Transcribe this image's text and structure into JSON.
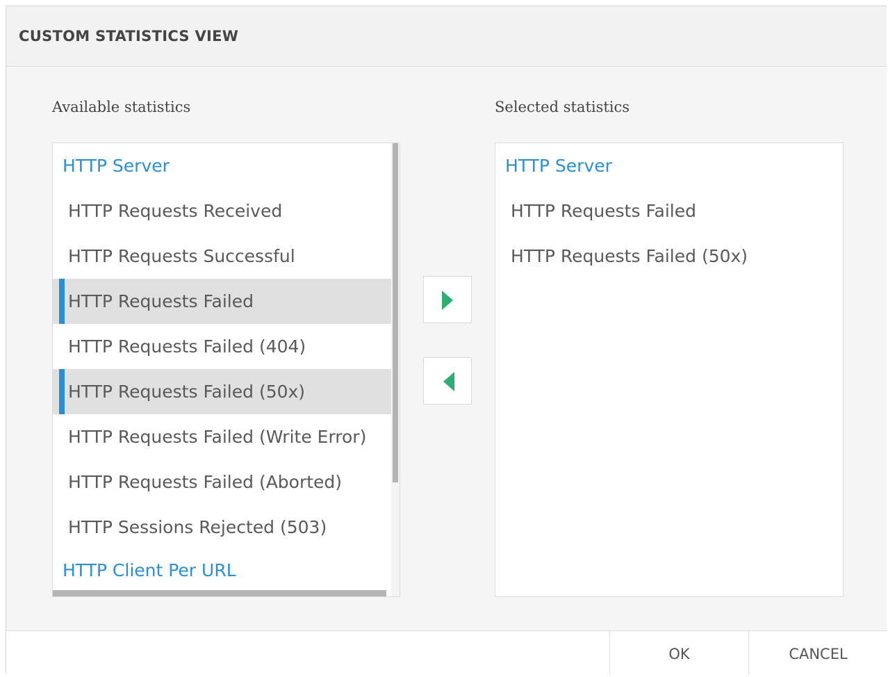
{
  "dialog": {
    "title": "CUSTOM STATISTICS VIEW",
    "available_label": "Available statistics",
    "selected_label": "Selected statistics"
  },
  "available": {
    "items": [
      {
        "label": "HTTP Server",
        "type": "group"
      },
      {
        "label": "HTTP Requests Received",
        "type": "item"
      },
      {
        "label": "HTTP Requests Successful",
        "type": "item"
      },
      {
        "label": "HTTP Requests Failed",
        "type": "item",
        "selected": true
      },
      {
        "label": "HTTP Requests Failed (404)",
        "type": "item"
      },
      {
        "label": "HTTP Requests Failed (50x)",
        "type": "item",
        "selected": true
      },
      {
        "label": "HTTP Requests Failed (Write Error)",
        "type": "item"
      },
      {
        "label": "HTTP Requests Failed (Aborted)",
        "type": "item"
      },
      {
        "label": "HTTP Sessions Rejected (503)",
        "type": "item"
      },
      {
        "label": "HTTP Client Per URL",
        "type": "group"
      }
    ]
  },
  "selected": {
    "items": [
      {
        "label": "HTTP Server",
        "type": "group"
      },
      {
        "label": "HTTP Requests Failed",
        "type": "item"
      },
      {
        "label": "HTTP Requests Failed (50x)",
        "type": "item"
      }
    ]
  },
  "buttons": {
    "add_icon": "arrow-right-icon",
    "remove_icon": "arrow-left-icon",
    "ok": "OK",
    "cancel": "CANCEL"
  },
  "colors": {
    "accent_blue": "#2b8fd6",
    "arrow_green": "#2fae72",
    "selection_gray": "#e0e0e0"
  }
}
